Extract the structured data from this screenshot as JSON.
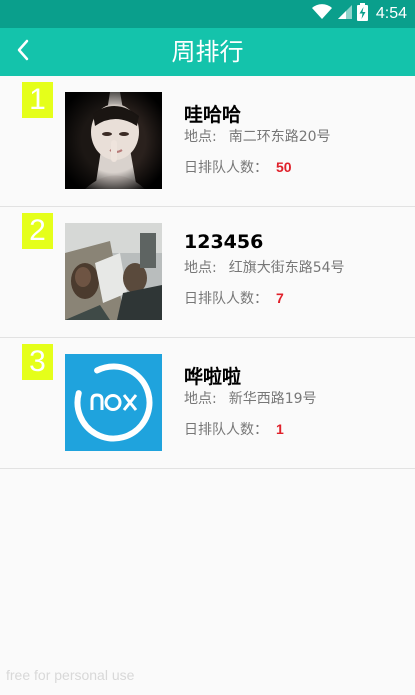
{
  "status_bar": {
    "time": "4:54",
    "icons": [
      "wifi-icon",
      "signal-icon",
      "battery-charging-icon"
    ]
  },
  "title_bar": {
    "back_icon": "chevron-left-icon",
    "title": "周排行"
  },
  "ranking": [
    {
      "rank": "1",
      "name": "哇哈哈",
      "address_label": "地点:",
      "address": "南二环东路20号",
      "count_label": "日排队人数：",
      "count": "50",
      "avatar": "photo-girl"
    },
    {
      "rank": "2",
      "name": "123456",
      "address_label": "地点:",
      "address": "红旗大街东路54号",
      "count_label": "日排队人数：",
      "count": "7",
      "avatar": "photo-group"
    },
    {
      "rank": "3",
      "name": "哗啦啦",
      "address_label": "地点:",
      "address": "新华西路19号",
      "count_label": "日排队人数：",
      "count": "1",
      "avatar": "nox-logo"
    }
  ],
  "watermark": "free for personal use",
  "colors": {
    "status_bar": "#0a9f8c",
    "title_bar": "#14c3ab",
    "rank_badge": "#e5ff1a",
    "count_value": "#e0202a"
  }
}
